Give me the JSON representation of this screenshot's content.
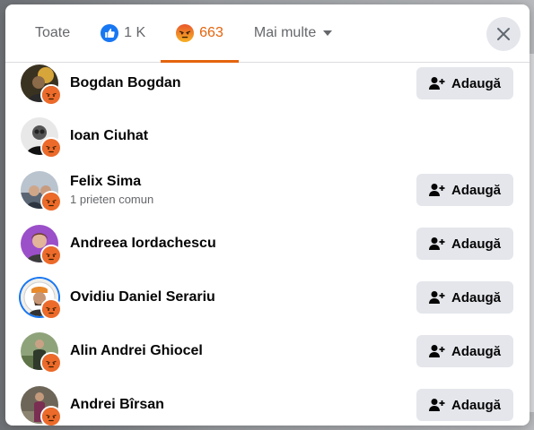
{
  "tabs": [
    {
      "label": "Toate"
    },
    {
      "icon": "like-reaction-icon",
      "count": "1 K"
    },
    {
      "icon": "angry-reaction-icon",
      "count": "663",
      "active": true
    },
    {
      "label": "Mai multe"
    }
  ],
  "colors": {
    "accent": "#e4640d",
    "like_blue": "#1877f2",
    "button_bg": "#e4e6eb"
  },
  "add_label": "Adaugă",
  "people": [
    {
      "name": "Bogdan Bogdan",
      "sub": "",
      "has_add": true
    },
    {
      "name": "Ioan Ciuhat",
      "sub": "",
      "has_add": false
    },
    {
      "name": "Felix Sima",
      "sub": "1 prieten comun",
      "has_add": true
    },
    {
      "name": "Andreea Iordachescu",
      "sub": "",
      "has_add": true
    },
    {
      "name": "Ovidiu Daniel Serariu",
      "sub": "",
      "has_add": true
    },
    {
      "name": "Alin Andrei Ghiocel",
      "sub": "",
      "has_add": true
    },
    {
      "name": "Andrei Bîrsan",
      "sub": "",
      "has_add": true
    }
  ]
}
